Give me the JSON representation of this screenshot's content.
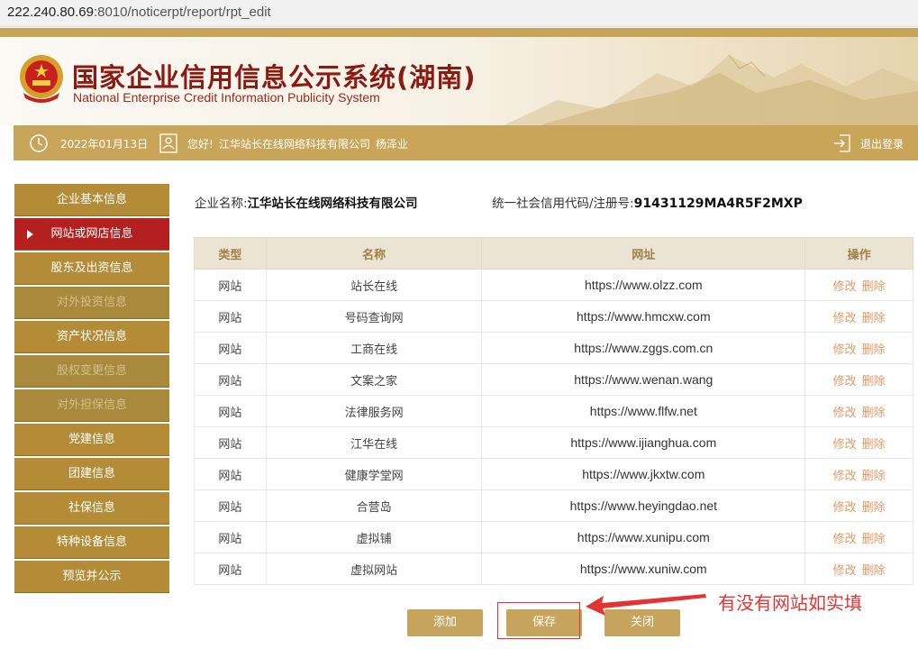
{
  "browser": {
    "url_host": "222.240.80.69",
    "url_path": ":8010/noticerpt/report/rpt_edit"
  },
  "header": {
    "title_cn": "国家企业信用信息公示系统(湖南)",
    "title_en": "National Enterprise Credit Information Publicity System"
  },
  "infobar": {
    "date": "2022年01月13日",
    "greeting": "您好!",
    "company": "江华站长在线网络科技有限公司",
    "user": "杨泽业",
    "logout": "退出登录"
  },
  "sidebar": {
    "items": [
      {
        "label": "企业基本信息",
        "state": "normal"
      },
      {
        "label": "网站或网店信息",
        "state": "active"
      },
      {
        "label": "股东及出资信息",
        "state": "normal"
      },
      {
        "label": "对外投资信息",
        "state": "disabled"
      },
      {
        "label": "资产状况信息",
        "state": "normal"
      },
      {
        "label": "股权变更信息",
        "state": "disabled"
      },
      {
        "label": "对外担保信息",
        "state": "disabled"
      },
      {
        "label": "党建信息",
        "state": "normal"
      },
      {
        "label": "团建信息",
        "state": "normal"
      },
      {
        "label": "社保信息",
        "state": "normal"
      },
      {
        "label": "特种设备信息",
        "state": "normal"
      },
      {
        "label": "预览并公示",
        "state": "normal"
      }
    ]
  },
  "company": {
    "name_label": "企业名称:",
    "name": "江华站长在线网络科技有限公司",
    "code_label": "统一社会信用代码/注册号:",
    "code": "91431129MA4R5F2MXP"
  },
  "table": {
    "headers": [
      "类型",
      "名称",
      "网址",
      "操作"
    ],
    "edit_label": "修改",
    "delete_label": "删除",
    "rows": [
      {
        "type": "网站",
        "name": "站长在线",
        "url": "https://www.olzz.com"
      },
      {
        "type": "网站",
        "name": "号码查询网",
        "url": "https://www.hmcxw.com"
      },
      {
        "type": "网站",
        "name": "工商在线",
        "url": "https://www.zggs.com.cn"
      },
      {
        "type": "网站",
        "name": "文案之家",
        "url": "https://www.wenan.wang"
      },
      {
        "type": "网站",
        "name": "法律服务网",
        "url": "https://www.flfw.net"
      },
      {
        "type": "网站",
        "name": "江华在线",
        "url": "https://www.ijianghua.com"
      },
      {
        "type": "网站",
        "name": "健康学堂网",
        "url": "https://www.jkxtw.com"
      },
      {
        "type": "网站",
        "name": "合营岛",
        "url": "https://www.heyingdao.net"
      },
      {
        "type": "网站",
        "name": "虚拟铺",
        "url": "https://www.xunipu.com"
      },
      {
        "type": "网站",
        "name": "虚拟网站",
        "url": "https://www.xuniw.com"
      }
    ]
  },
  "actions": {
    "add": "添加",
    "save": "保存",
    "close": "关闭"
  },
  "annotation": "有没有网站如实填",
  "colors": {
    "gold": "#c9a55a",
    "sidebar": "#b48c38",
    "active": "#b3201f",
    "link": "#e09a66",
    "annotation": "#e33333"
  }
}
